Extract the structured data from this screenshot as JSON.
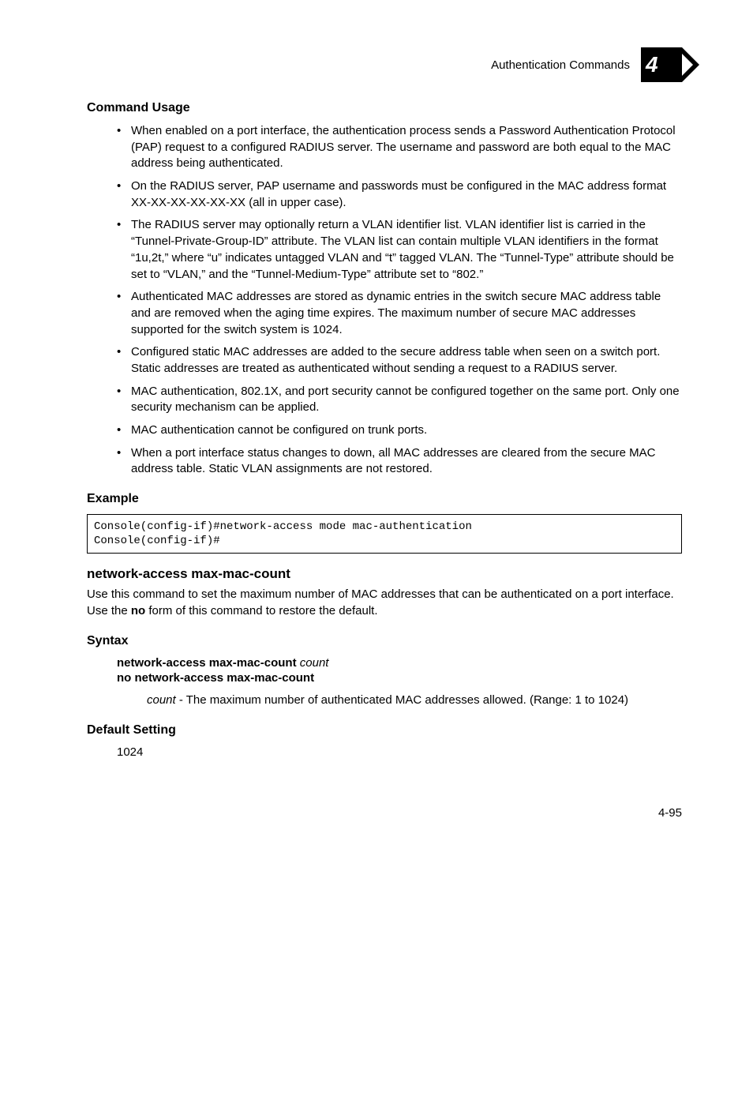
{
  "header": {
    "title": "Authentication Commands",
    "chapter": "4"
  },
  "section1": {
    "heading": "Command Usage",
    "bullets": [
      "When enabled on a port interface, the authentication process sends a Password Authentication Protocol (PAP) request to a configured RADIUS server. The username and password are both equal to the MAC address being authenticated.",
      "On the RADIUS server, PAP username and passwords must be configured in the MAC address format XX-XX-XX-XX-XX-XX (all in upper case).",
      "The RADIUS server may optionally return a VLAN identifier list. VLAN identifier list is carried in the “Tunnel-Private-Group-ID” attribute. The VLAN list can contain multiple VLAN identifiers in the format “1u,2t,” where “u” indicates untagged VLAN and “t” tagged VLAN. The “Tunnel-Type” attribute should be set to “VLAN,” and the “Tunnel-Medium-Type” attribute set to “802.”",
      "Authenticated MAC addresses are stored as dynamic entries in the switch secure MAC address table and are removed when the aging time expires. The maximum number of secure MAC addresses supported for the switch system is 1024.",
      "Configured static MAC addresses are added to the secure address table when seen on a switch port. Static addresses are treated as authenticated without sending a request to a RADIUS server.",
      "MAC authentication, 802.1X, and port security cannot be configured together on the same port. Only one security mechanism can be applied.",
      "MAC authentication cannot be configured on trunk ports.",
      "When a port interface status changes to down, all MAC addresses are cleared from the secure MAC address table. Static VLAN assignments are not restored."
    ]
  },
  "example": {
    "heading": "Example",
    "code": "Console(config-if)#network-access mode mac-authentication\nConsole(config-if)#"
  },
  "command": {
    "name": "network-access max-mac-count",
    "desc_pre": "Use this command to set the maximum number of MAC addresses that can be authenticated on a port interface. Use the ",
    "desc_bold": "no",
    "desc_post": " form of this command to restore the default."
  },
  "syntax": {
    "heading": "Syntax",
    "line1_bold": "network-access max-mac-count ",
    "line1_italic": "count",
    "line2_bold": "no network-access max-mac-count",
    "param_italic": "count",
    "param_text": " - The maximum number of authenticated MAC addresses allowed. (Range: 1 to 1024)"
  },
  "default": {
    "heading": "Default Setting",
    "value": "1024"
  },
  "footer": {
    "page": "4-95"
  }
}
